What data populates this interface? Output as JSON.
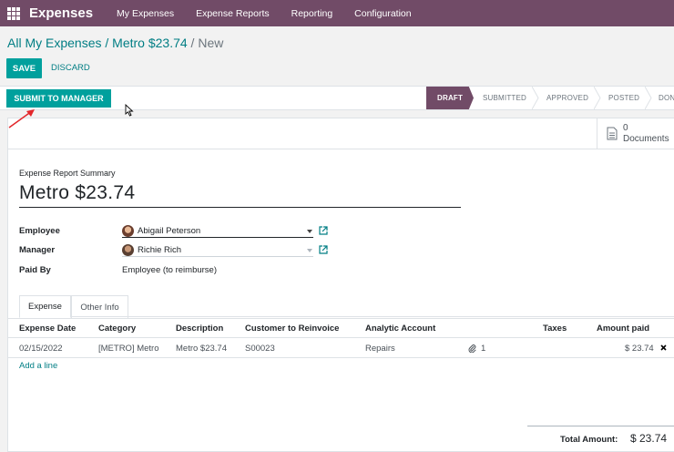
{
  "navbar": {
    "app_name": "Expenses",
    "menu": [
      "My Expenses",
      "Expense Reports",
      "Reporting",
      "Configuration"
    ]
  },
  "breadcrumb": {
    "parent": "All My Expenses",
    "record": "Metro $23.74",
    "current": "New",
    "sep": "/"
  },
  "actions": {
    "save": "SAVE",
    "discard": "DISCARD",
    "submit": "SUBMIT TO MANAGER"
  },
  "stages": [
    "DRAFT",
    "SUBMITTED",
    "APPROVED",
    "POSTED",
    "DONE"
  ],
  "active_stage": "DRAFT",
  "documents": {
    "count": "0",
    "label": "Documents"
  },
  "form": {
    "summary_label": "Expense Report Summary",
    "summary_value": "Metro $23.74",
    "employee_label": "Employee",
    "employee_value": "Abigail Peterson",
    "manager_label": "Manager",
    "manager_value": "Richie Rich",
    "paid_by_label": "Paid By",
    "paid_by_value": "Employee (to reimburse)"
  },
  "tabs": [
    "Expense",
    "Other Info"
  ],
  "table": {
    "headers": [
      "Expense Date",
      "Category",
      "Description",
      "Customer to Reinvoice",
      "Analytic Account",
      "Taxes",
      "Amount paid"
    ],
    "rows": [
      {
        "date": "02/15/2022",
        "category": "[METRO] Metro",
        "description": "Metro $23.74",
        "customer": "S00023",
        "analytic": "Repairs",
        "attachments": "1",
        "taxes": "",
        "amount": "$ 23.74"
      }
    ],
    "add_line": "Add a line"
  },
  "total": {
    "label": "Total Amount:",
    "value": "$ 23.74"
  },
  "colors": {
    "brand": "#714b67",
    "primary": "#00a09d",
    "link": "#017e84"
  }
}
